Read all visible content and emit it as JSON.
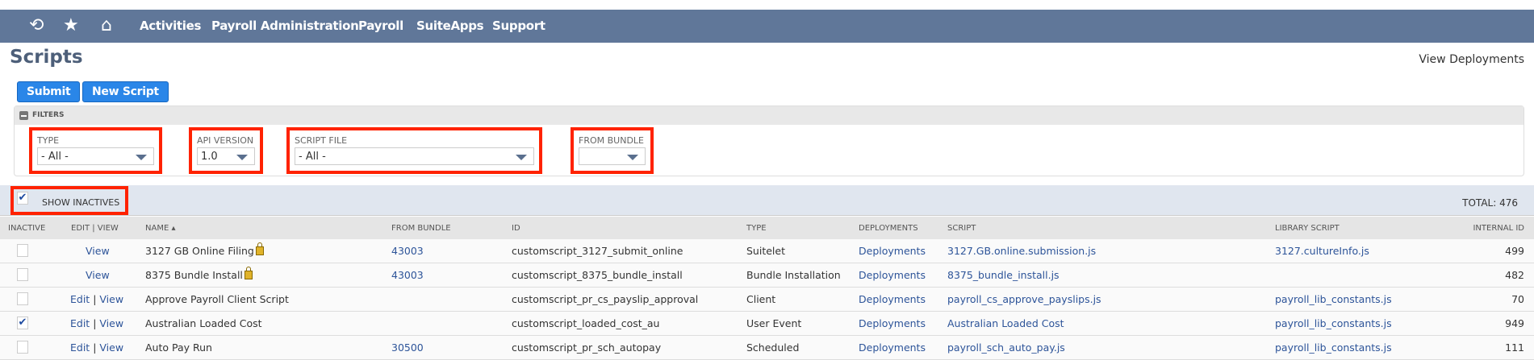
{
  "nav": {
    "items": [
      "Activities",
      "Payroll Administration",
      "Payroll",
      "SuiteApps",
      "Support"
    ]
  },
  "page": {
    "title": "Scripts",
    "view_deployments": "View Deployments"
  },
  "buttons": {
    "submit": "Submit",
    "new_script": "New Script"
  },
  "filters": {
    "header": "FILTERS",
    "type": {
      "label": "TYPE",
      "value": "- All -"
    },
    "api": {
      "label": "API VERSION",
      "value": "1.0"
    },
    "script_file": {
      "label": "SCRIPT FILE",
      "value": "- All -"
    },
    "bundle": {
      "label": "FROM BUNDLE",
      "value": ""
    }
  },
  "show_inactives": {
    "label": "SHOW INACTIVES",
    "checked": true
  },
  "total": "TOTAL: 476",
  "columns": [
    "INACTIVE",
    "EDIT | VIEW",
    "NAME ▴",
    "FROM BUNDLE",
    "ID",
    "TYPE",
    "DEPLOYMENTS",
    "SCRIPT",
    "LIBRARY SCRIPT",
    "INTERNAL ID"
  ],
  "rows": [
    {
      "inactive": false,
      "edit": "",
      "view": "View",
      "name": "3127 GB Online Filing",
      "locked": true,
      "bundle": "43003",
      "id": "customscript_3127_submit_online",
      "type": "Suitelet",
      "deployments": "Deployments",
      "script": "3127.GB.online.submission.js",
      "library": "3127.cultureInfo.js",
      "internal_id": "499"
    },
    {
      "inactive": false,
      "edit": "",
      "view": "View",
      "name": "8375 Bundle Install",
      "locked": true,
      "bundle": "43003",
      "id": "customscript_8375_bundle_install",
      "type": "Bundle Installation",
      "deployments": "Deployments",
      "script": "8375_bundle_install.js",
      "library": "",
      "internal_id": "482"
    },
    {
      "inactive": false,
      "edit": "Edit",
      "view": "View",
      "name": "Approve Payroll Client Script",
      "locked": false,
      "bundle": "",
      "id": "customscript_pr_cs_payslip_approval",
      "type": "Client",
      "deployments": "Deployments",
      "script": "payroll_cs_approve_payslips.js",
      "library": "payroll_lib_constants.js",
      "internal_id": "70"
    },
    {
      "inactive": true,
      "edit": "Edit",
      "view": "View",
      "name": "Australian Loaded Cost",
      "locked": false,
      "bundle": "",
      "id": "customscript_loaded_cost_au",
      "type": "User Event",
      "deployments": "Deployments",
      "script": "Australian Loaded Cost",
      "library": "payroll_lib_constants.js",
      "internal_id": "949"
    },
    {
      "inactive": false,
      "edit": "Edit",
      "view": "View",
      "name": "Auto Pay Run",
      "locked": false,
      "bundle": "30500",
      "id": "customscript_pr_sch_autopay",
      "type": "Scheduled",
      "deployments": "Deployments",
      "script": "payroll_sch_auto_pay.js",
      "library": "payroll_lib_constants.js",
      "internal_id": "111"
    }
  ]
}
